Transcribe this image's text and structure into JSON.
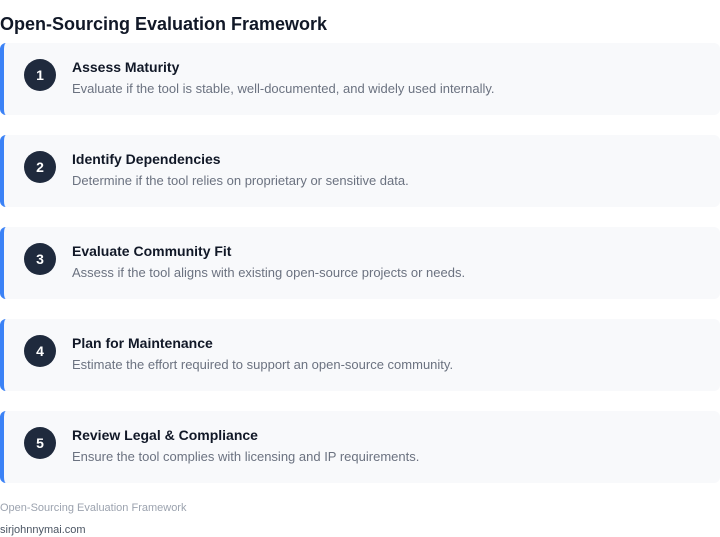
{
  "page": {
    "title": "Open-Sourcing Evaluation Framework"
  },
  "steps": [
    {
      "number": "1",
      "title": "Assess Maturity",
      "description": "Evaluate if the tool is stable, well-documented, and widely used internally."
    },
    {
      "number": "2",
      "title": "Identify Dependencies",
      "description": "Determine if the tool relies on proprietary or sensitive data."
    },
    {
      "number": "3",
      "title": "Evaluate Community Fit",
      "description": "Assess if the tool aligns with existing open-source projects or needs."
    },
    {
      "number": "4",
      "title": "Plan for Maintenance",
      "description": "Estimate the effort required to support an open-source community."
    },
    {
      "number": "5",
      "title": "Review Legal & Compliance",
      "description": "Ensure the tool complies with licensing and IP requirements."
    }
  ],
  "footer": {
    "caption": "Open-Sourcing Evaluation Framework",
    "source": "sirjohnnymai.com"
  },
  "colors": {
    "accent": "#3b82f6",
    "badge": "#1f2a3d",
    "card_background": "#f8f9fb"
  }
}
